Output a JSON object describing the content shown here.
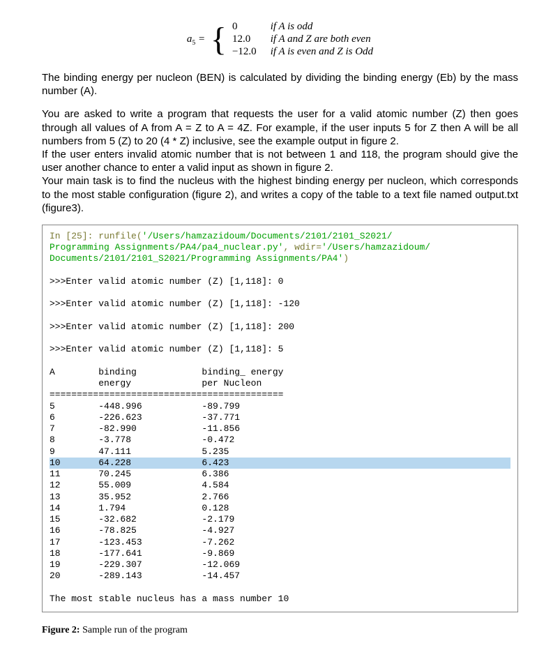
{
  "formula": {
    "lhs": "a",
    "sub": "5",
    "eq": " = ",
    "cases": [
      {
        "val": "0",
        "cond": "if A is odd"
      },
      {
        "val": "12.0",
        "cond": "if A and Z are both even"
      },
      {
        "val": "−12.0",
        "cond": "if A is even and Z is Odd"
      }
    ]
  },
  "p1": "The binding energy per nucleon (BEN) is calculated by dividing the binding energy (Eb) by the mass number (A).",
  "p2": "You are asked to write a program that requests the user for a valid atomic number (Z) then goes through all values of A from A = Z to A = 4Z. For example, if the user inputs 5 for Z then A will be all numbers from 5 (Z) to 20 (4 * Z) inclusive, see the example output in figure 2.",
  "p3": "If the user enters invalid atomic number that is not between 1 and 118, the program should give the user another chance to enter a valid input as shown in figure 2.",
  "p4": "Your main task is to find the nucleus with the highest binding energy per nucleon, which corresponds to the most stable configuration (figure 2), and writes a copy of the table to a text file named output.txt (figure3).",
  "console": {
    "in_label": "In [25]: ",
    "runfile_a": "runfile(",
    "runfile_b": "'/Users/hamzazidoum/Documents/2101/2101_S2021/\nProgramming Assignments/PA4/pa4_nuclear.py'",
    "runfile_c": ", wdir=",
    "runfile_d": "'/Users/hamzazidoum/\nDocuments/2101/2101_S2021/Programming Assignments/PA4'",
    "runfile_e": ")",
    "prompts": [
      ">>>Enter valid atomic number (Z) [1,118]: 0",
      ">>>Enter valid atomic number (Z) [1,118]: -120",
      ">>>Enter valid atomic number (Z) [1,118]: 200",
      ">>>Enter valid atomic number (Z) [1,118]: 5"
    ],
    "header1": "A        binding            binding_ energy",
    "header2": "         energy             per Nucleon",
    "divider": "===========================================",
    "result": "The most stable nucleus has a mass number 10"
  },
  "chart_data": {
    "type": "table",
    "title": "Binding energy output for Z=5",
    "columns": [
      "A",
      "binding energy",
      "binding energy per Nucleon"
    ],
    "rows": [
      {
        "A": 5,
        "binding_energy": -448.996,
        "per_nucleon": -89.799,
        "highlight": false
      },
      {
        "A": 6,
        "binding_energy": -226.623,
        "per_nucleon": -37.771,
        "highlight": false
      },
      {
        "A": 7,
        "binding_energy": -82.99,
        "per_nucleon": -11.856,
        "highlight": false
      },
      {
        "A": 8,
        "binding_energy": -3.778,
        "per_nucleon": -0.472,
        "highlight": false
      },
      {
        "A": 9,
        "binding_energy": 47.111,
        "per_nucleon": 5.235,
        "highlight": false
      },
      {
        "A": 10,
        "binding_energy": 64.228,
        "per_nucleon": 6.423,
        "highlight": true
      },
      {
        "A": 11,
        "binding_energy": 70.245,
        "per_nucleon": 6.386,
        "highlight": false
      },
      {
        "A": 12,
        "binding_energy": 55.009,
        "per_nucleon": 4.584,
        "highlight": false
      },
      {
        "A": 13,
        "binding_energy": 35.952,
        "per_nucleon": 2.766,
        "highlight": false
      },
      {
        "A": 14,
        "binding_energy": 1.794,
        "per_nucleon": 0.128,
        "highlight": false
      },
      {
        "A": 15,
        "binding_energy": -32.682,
        "per_nucleon": -2.179,
        "highlight": false
      },
      {
        "A": 16,
        "binding_energy": -78.825,
        "per_nucleon": -4.927,
        "highlight": false
      },
      {
        "A": 17,
        "binding_energy": -123.453,
        "per_nucleon": -7.262,
        "highlight": false
      },
      {
        "A": 18,
        "binding_energy": -177.641,
        "per_nucleon": -9.869,
        "highlight": false
      },
      {
        "A": 19,
        "binding_energy": -229.307,
        "per_nucleon": -12.069,
        "highlight": false
      },
      {
        "A": 20,
        "binding_energy": -289.143,
        "per_nucleon": -14.457,
        "highlight": false
      }
    ]
  },
  "figcap_bold": "Figure 2:",
  "figcap_rest": " Sample run of the program"
}
